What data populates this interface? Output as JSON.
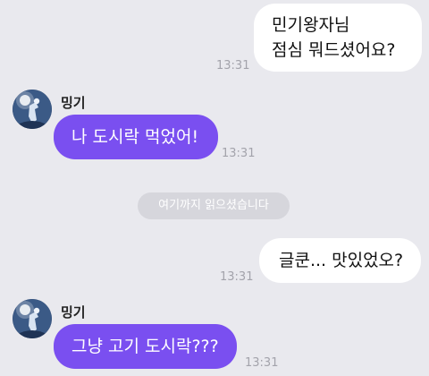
{
  "messages": [
    {
      "lines": [
        "민기왕자님",
        "점심 뭐드셨어요?"
      ],
      "time": "13:31"
    },
    {
      "sender": "밍기",
      "text": "나 도시락 먹었어!",
      "time": "13:31"
    },
    {
      "text": "글쿤... 맛있었오?",
      "time": "13:31"
    },
    {
      "sender": "밍기",
      "text": "그냥 고기 도시락???",
      "time": "13:31"
    }
  ],
  "read_notice": "여기까지 읽으셨습니다",
  "colors": {
    "background": "#e9e9ee",
    "outgoing_bubble": "#ffffff",
    "incoming_bubble": "#7a4ff0",
    "time_text": "#a3a3ab",
    "notice_bg": "#d6d6dc"
  },
  "icons": {
    "avatar": "profile-avatar-icon"
  }
}
